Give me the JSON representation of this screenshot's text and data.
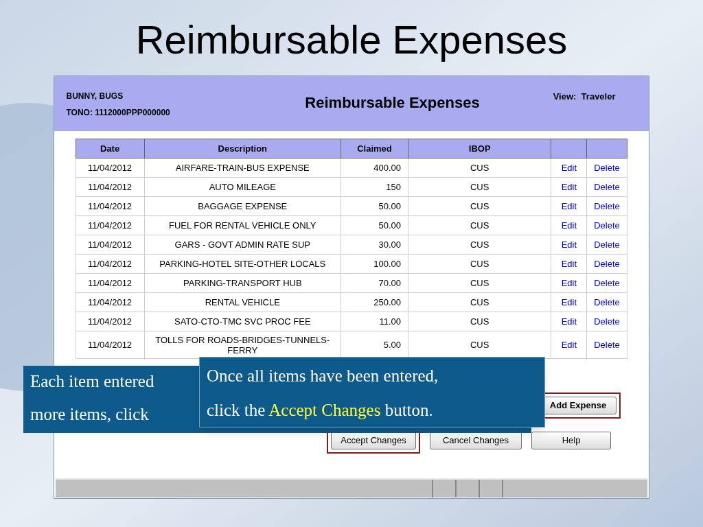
{
  "slide_title": "Reimbursable Expenses",
  "header": {
    "traveler": "BUNNY, BUGS",
    "tono": "TONO: 1112000PPP000000",
    "title": "Reimbursable Expenses",
    "view": "View:  Traveler"
  },
  "table": {
    "columns": [
      "Date",
      "Description",
      "Claimed",
      "IBOP",
      "",
      ""
    ],
    "rows": [
      {
        "date": "11/04/2012",
        "description": "AIRFARE-TRAIN-BUS EXPENSE",
        "claimed": "400.00",
        "ibop": "CUS",
        "edit": "Edit",
        "delete": "Delete"
      },
      {
        "date": "11/04/2012",
        "description": "AUTO MILEAGE",
        "claimed": "150",
        "ibop": "CUS",
        "edit": "Edit",
        "delete": "Delete"
      },
      {
        "date": "11/04/2012",
        "description": "BAGGAGE EXPENSE",
        "claimed": "50.00",
        "ibop": "CUS",
        "edit": "Edit",
        "delete": "Delete"
      },
      {
        "date": "11/04/2012",
        "description": "FUEL FOR RENTAL VEHICLE ONLY",
        "claimed": "50.00",
        "ibop": "CUS",
        "edit": "Edit",
        "delete": "Delete"
      },
      {
        "date": "11/04/2012",
        "description": "GARS - GOVT ADMIN RATE SUP",
        "claimed": "30.00",
        "ibop": "CUS",
        "edit": "Edit",
        "delete": "Delete"
      },
      {
        "date": "11/04/2012",
        "description": "PARKING-HOTEL SITE-OTHER LOCALS",
        "claimed": "100.00",
        "ibop": "CUS",
        "edit": "Edit",
        "delete": "Delete"
      },
      {
        "date": "11/04/2012",
        "description": "PARKING-TRANSPORT HUB",
        "claimed": "70.00",
        "ibop": "CUS",
        "edit": "Edit",
        "delete": "Delete"
      },
      {
        "date": "11/04/2012",
        "description": "RENTAL VEHICLE",
        "claimed": "250.00",
        "ibop": "CUS",
        "edit": "Edit",
        "delete": "Delete"
      },
      {
        "date": "11/04/2012",
        "description": "SATO-CTO-TMC SVC PROC FEE",
        "claimed": "11.00",
        "ibop": "CUS",
        "edit": "Edit",
        "delete": "Delete"
      },
      {
        "date": "11/04/2012",
        "description": "TOLLS FOR ROADS-BRIDGES-TUNNELS-FERRY",
        "claimed": "5.00",
        "ibop": "CUS",
        "edit": "Edit",
        "delete": "Delete"
      }
    ]
  },
  "buttons_row_1": [
    {
      "label": "Add Expense",
      "highlighted": true
    }
  ],
  "buttons_row_2": [
    {
      "label": "Accept Changes",
      "highlighted": true
    },
    {
      "label": "Cancel Changes",
      "highlighted": false
    },
    {
      "label": "Help",
      "highlighted": false
    }
  ],
  "callout_back": [
    "Each item entered",
    "more items, click"
  ],
  "callout_front": [
    [
      {
        "kind": "plain",
        "text": "Once all items have been entered,"
      }
    ],
    [
      {
        "kind": "plain",
        "text": "click the "
      },
      {
        "kind": "highlight",
        "text": "Accept Changes"
      },
      {
        "kind": "plain",
        "text": " button."
      }
    ]
  ]
}
